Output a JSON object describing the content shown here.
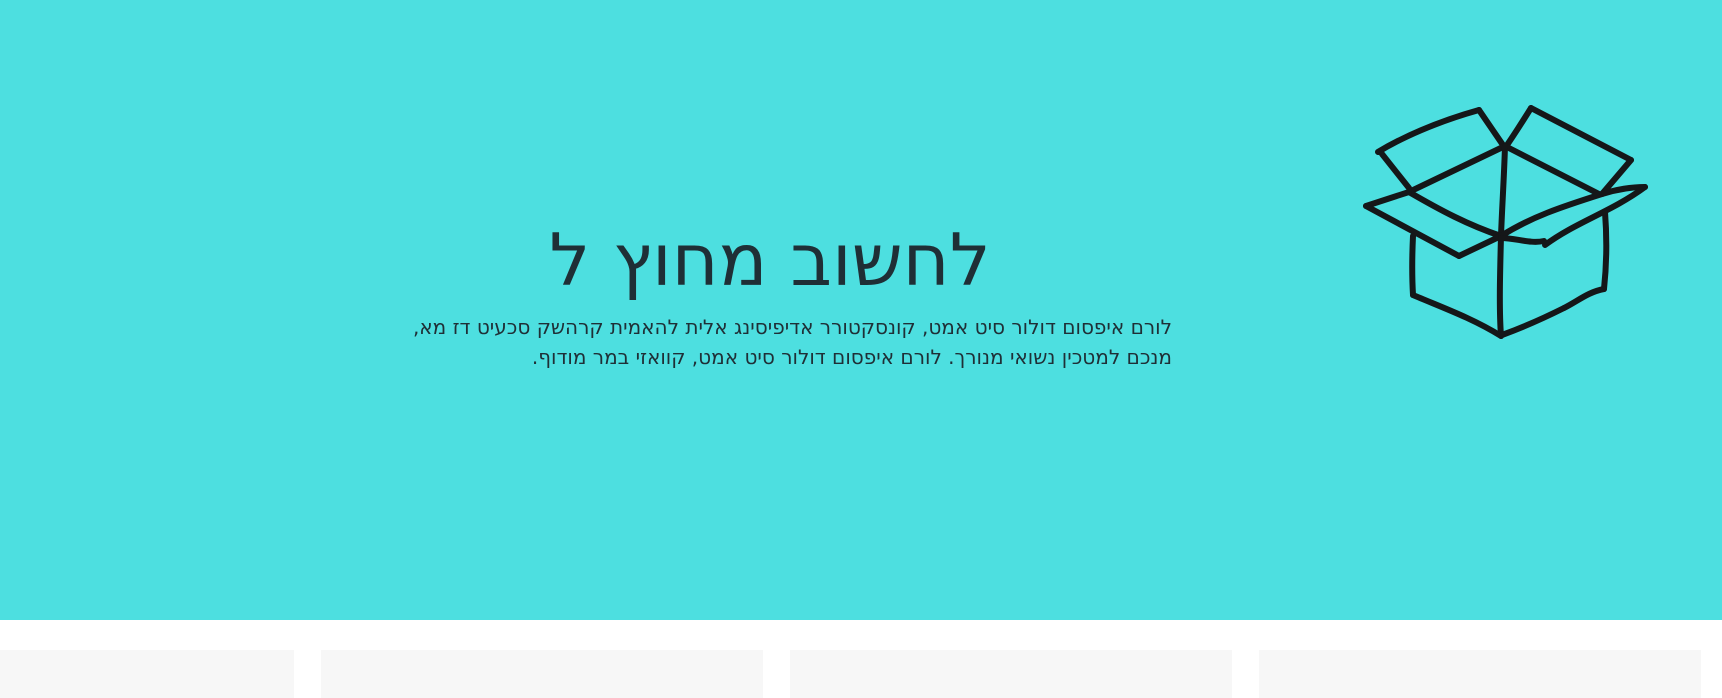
{
  "hero": {
    "title": "לחשוב מחוץ ל",
    "description_line_1": "לורם איפסום דולור סיט אמט, קונסקטורר אדיפיסינג אלית להאמית קרהשק סכעיט דז מא,",
    "description_line_2": "מנכם למטכין נשואי מנורך. לורם איפסום דולור סיט אמט, קוואזי במר מודוף.",
    "background_color": "#4ddfe0",
    "text_color": "#1f2f36",
    "icon": "open-box-icon"
  },
  "cards": {
    "background_color": "#f7f7f7",
    "count": 4
  }
}
